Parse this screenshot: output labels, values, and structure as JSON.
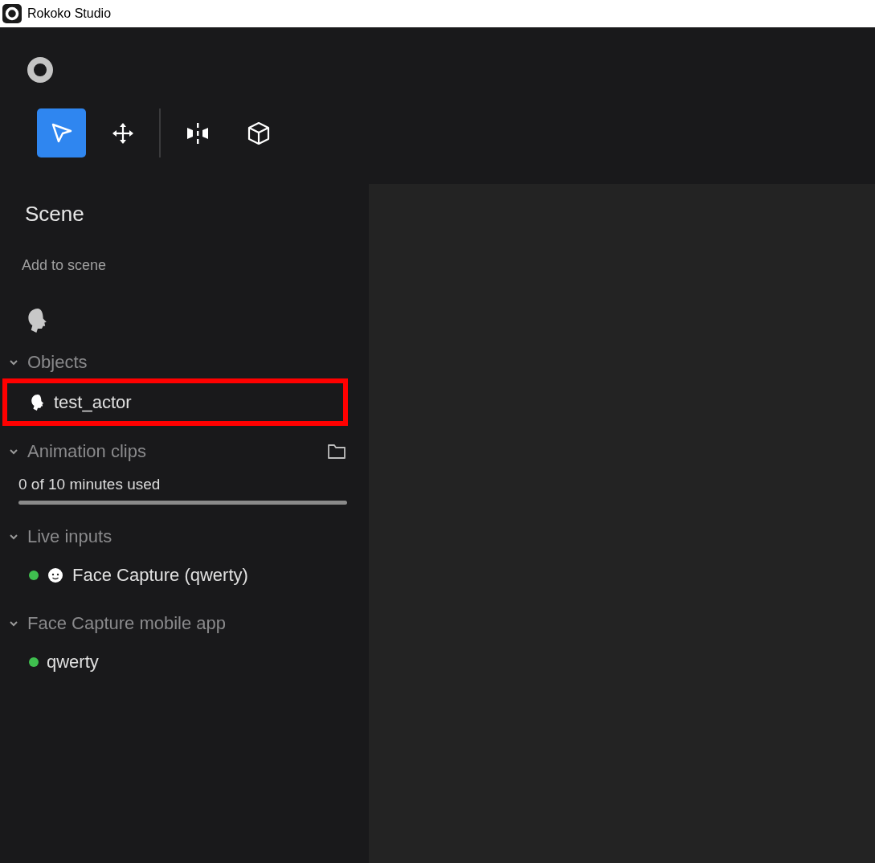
{
  "window": {
    "title": "Rokoko Studio"
  },
  "toolbar": [
    {
      "kind": "select",
      "selected": true
    },
    {
      "kind": "move",
      "selected": false
    },
    {
      "kind": "separator"
    },
    {
      "kind": "mirror",
      "selected": false
    },
    {
      "kind": "cube",
      "selected": false
    }
  ],
  "panel": {
    "title": "Scene",
    "add_label": "Add to scene",
    "sections": [
      {
        "title": "Objects",
        "expanded": true,
        "items": [
          {
            "kind": "actor",
            "label": "test_actor",
            "highlighted": true
          }
        ]
      },
      {
        "title": "Animation clips",
        "expanded": true,
        "has_folder": true,
        "usage": "0 of 10 minutes used"
      },
      {
        "title": "Live inputs",
        "expanded": true,
        "items": [
          {
            "kind": "face",
            "label": "Face Capture (qwerty)",
            "color": "#3fbf4f"
          }
        ]
      },
      {
        "title": "Face Capture mobile app",
        "expanded": true,
        "items": [
          {
            "kind": "device",
            "label": "qwerty",
            "color": "#3fbf4f"
          }
        ]
      }
    ]
  }
}
